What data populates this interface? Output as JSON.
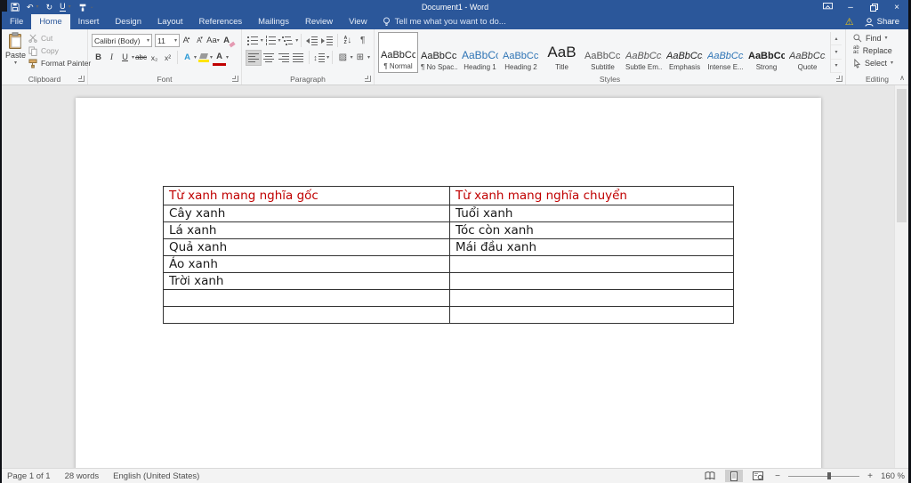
{
  "colors": {
    "titlebar": "#2b579a",
    "table_header_text": "#c00000",
    "highlight": "#ffe400"
  },
  "icons": {
    "caret": "▾",
    "caret_small": "⌄",
    "undo": "↶",
    "redo": "↻",
    "minimize": "–",
    "close": "×",
    "warning": "⚠",
    "pilcrow": "¶",
    "collapse": "∧",
    "up": "▴",
    "down": "▾",
    "minus": "−",
    "plus": "+",
    "line_spacing": "↕",
    "borders": "⊞",
    "shading": "▨",
    "sort_a": "A",
    "sort_z": "Z",
    "sort_arrow": "↓",
    "replace_top": "ab",
    "replace_bottom": "ac"
  },
  "window": {
    "title": "Document1 - Word",
    "share": "Share"
  },
  "tabs": [
    {
      "label": "File"
    },
    {
      "label": "Home"
    },
    {
      "label": "Insert"
    },
    {
      "label": "Design"
    },
    {
      "label": "Layout"
    },
    {
      "label": "References"
    },
    {
      "label": "Mailings"
    },
    {
      "label": "Review"
    },
    {
      "label": "View"
    }
  ],
  "tell_me": "Tell me what you want to do...",
  "ribbon": {
    "clipboard": {
      "label": "Clipboard",
      "paste": "Paste",
      "cut": "Cut",
      "copy": "Copy",
      "format_painter": "Format Painter"
    },
    "font": {
      "label": "Font",
      "name": "Calibri (Body)",
      "size": "11",
      "bold": "B",
      "italic": "I",
      "underline": "U",
      "strike": "abc",
      "subscript": "x₂",
      "superscript": "x²",
      "grow": "A",
      "shrink": "A",
      "case": "Aa",
      "clear": "A",
      "effects": "A",
      "color": "A"
    },
    "paragraph": {
      "label": "Paragraph"
    },
    "styles": {
      "label": "Styles",
      "items": [
        {
          "preview": "AaBbCcDc",
          "name": "¶ Normal"
        },
        {
          "preview": "AaBbCcDc",
          "name": "¶ No Spac..."
        },
        {
          "preview": "AaBbCc",
          "name": "Heading 1"
        },
        {
          "preview": "AaBbCcC",
          "name": "Heading 2"
        },
        {
          "preview": "AaB",
          "name": "Title"
        },
        {
          "preview": "AaBbCcD",
          "name": "Subtitle"
        },
        {
          "preview": "AaBbCcDt",
          "name": "Subtle Em..."
        },
        {
          "preview": "AaBbCcDt",
          "name": "Emphasis"
        },
        {
          "preview": "AaBbCcDt",
          "name": "Intense E..."
        },
        {
          "preview": "AaBbCcDc",
          "name": "Strong"
        },
        {
          "preview": "AaBbCcDt",
          "name": "Quote"
        }
      ]
    },
    "editing": {
      "label": "Editing",
      "find": "Find",
      "replace": "Replace",
      "select": "Select"
    }
  },
  "document": {
    "table": {
      "header": [
        "Từ xanh mang nghĩa gốc",
        "Từ xanh mang nghĩa chuyển"
      ],
      "rows": [
        [
          "Cây xanh",
          "Tuổi xanh"
        ],
        [
          "Lá xanh",
          "Tóc còn xanh"
        ],
        [
          "Quả xanh",
          "Mái đầu xanh"
        ],
        [
          "Áo xanh",
          ""
        ],
        [
          "Trời xanh",
          ""
        ],
        [
          "",
          ""
        ],
        [
          "",
          ""
        ]
      ]
    }
  },
  "status": {
    "page": "Page 1 of 1",
    "words": "28 words",
    "language": "English (United States)",
    "zoom": "160 %"
  }
}
